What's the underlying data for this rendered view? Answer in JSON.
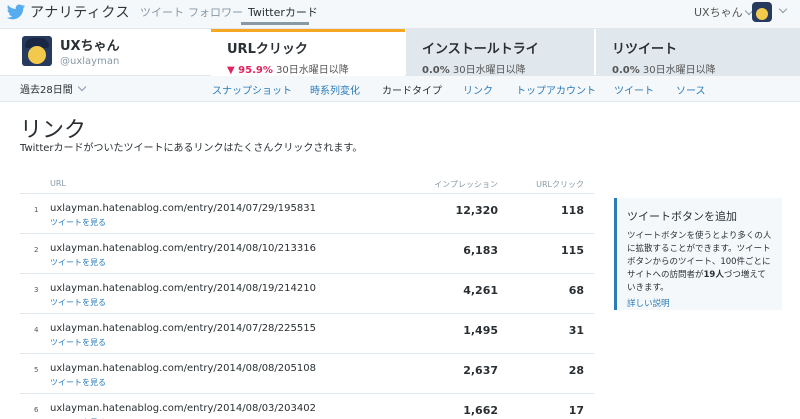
{
  "brand": {
    "title": "アナリティクス"
  },
  "nav": [
    {
      "label": "ツイート"
    },
    {
      "label": "フォロワー"
    },
    {
      "label": "Twitterカード"
    }
  ],
  "user": {
    "name": "UXちゃん"
  },
  "account": {
    "name": "UXちゃん",
    "handle": "@uxlayman"
  },
  "metrics": [
    {
      "label": "URLクリック",
      "change": "▼ 95.9%",
      "period": "30日水曜日以降"
    },
    {
      "label": "インストールトライ",
      "change": "0.0%",
      "period": "30日水曜日以降"
    },
    {
      "label": "リツイート",
      "change": "0.0%",
      "period": "30日水曜日以降"
    }
  ],
  "period_select": {
    "label": "過去28日間"
  },
  "subnav": [
    {
      "label": "スナップショット"
    },
    {
      "label": "時系列変化"
    },
    {
      "label": "カードタイプ"
    },
    {
      "label": "リンク"
    },
    {
      "label": "トップアカウント"
    },
    {
      "label": "ツイート"
    },
    {
      "label": "ソース"
    }
  ],
  "page": {
    "title": "リンク",
    "description": "Twitterカードがついたツイートにあるリンクはたくさんクリックされます。"
  },
  "table": {
    "headers": {
      "url": "URL",
      "impressions": "インプレッション",
      "clicks": "URLクリック"
    },
    "view_link": "ツイートを見る",
    "rows": [
      {
        "rank": "1",
        "url": "uxlayman.hatenablog.com/entry/2014/07/29/195831",
        "impressions": "12,320",
        "clicks": "118"
      },
      {
        "rank": "2",
        "url": "uxlayman.hatenablog.com/entry/2014/08/10/213316",
        "impressions": "6,183",
        "clicks": "115"
      },
      {
        "rank": "3",
        "url": "uxlayman.hatenablog.com/entry/2014/08/19/214210",
        "impressions": "4,261",
        "clicks": "68"
      },
      {
        "rank": "4",
        "url": "uxlayman.hatenablog.com/entry/2014/07/28/225515",
        "impressions": "1,495",
        "clicks": "31"
      },
      {
        "rank": "5",
        "url": "uxlayman.hatenablog.com/entry/2014/08/08/205108",
        "impressions": "2,637",
        "clicks": "28"
      },
      {
        "rank": "6",
        "url": "uxlayman.hatenablog.com/entry/2014/08/03/203402",
        "impressions": "1,662",
        "clicks": "17"
      }
    ]
  },
  "sidebar": {
    "title": "ツイートボタンを追加",
    "body_1": "ツイートボタンを使うとより多くの人に拡散することができます。ツイートボタンからのツイート、100件ごとにサイトへの訪問者が",
    "body_bold": "19人",
    "body_2": "づつ増えていきます。",
    "link": "詳しい説明"
  },
  "colors": {
    "accent": "#2b7bb9",
    "active_tab": "#f5a623",
    "down": "#e0245e"
  }
}
